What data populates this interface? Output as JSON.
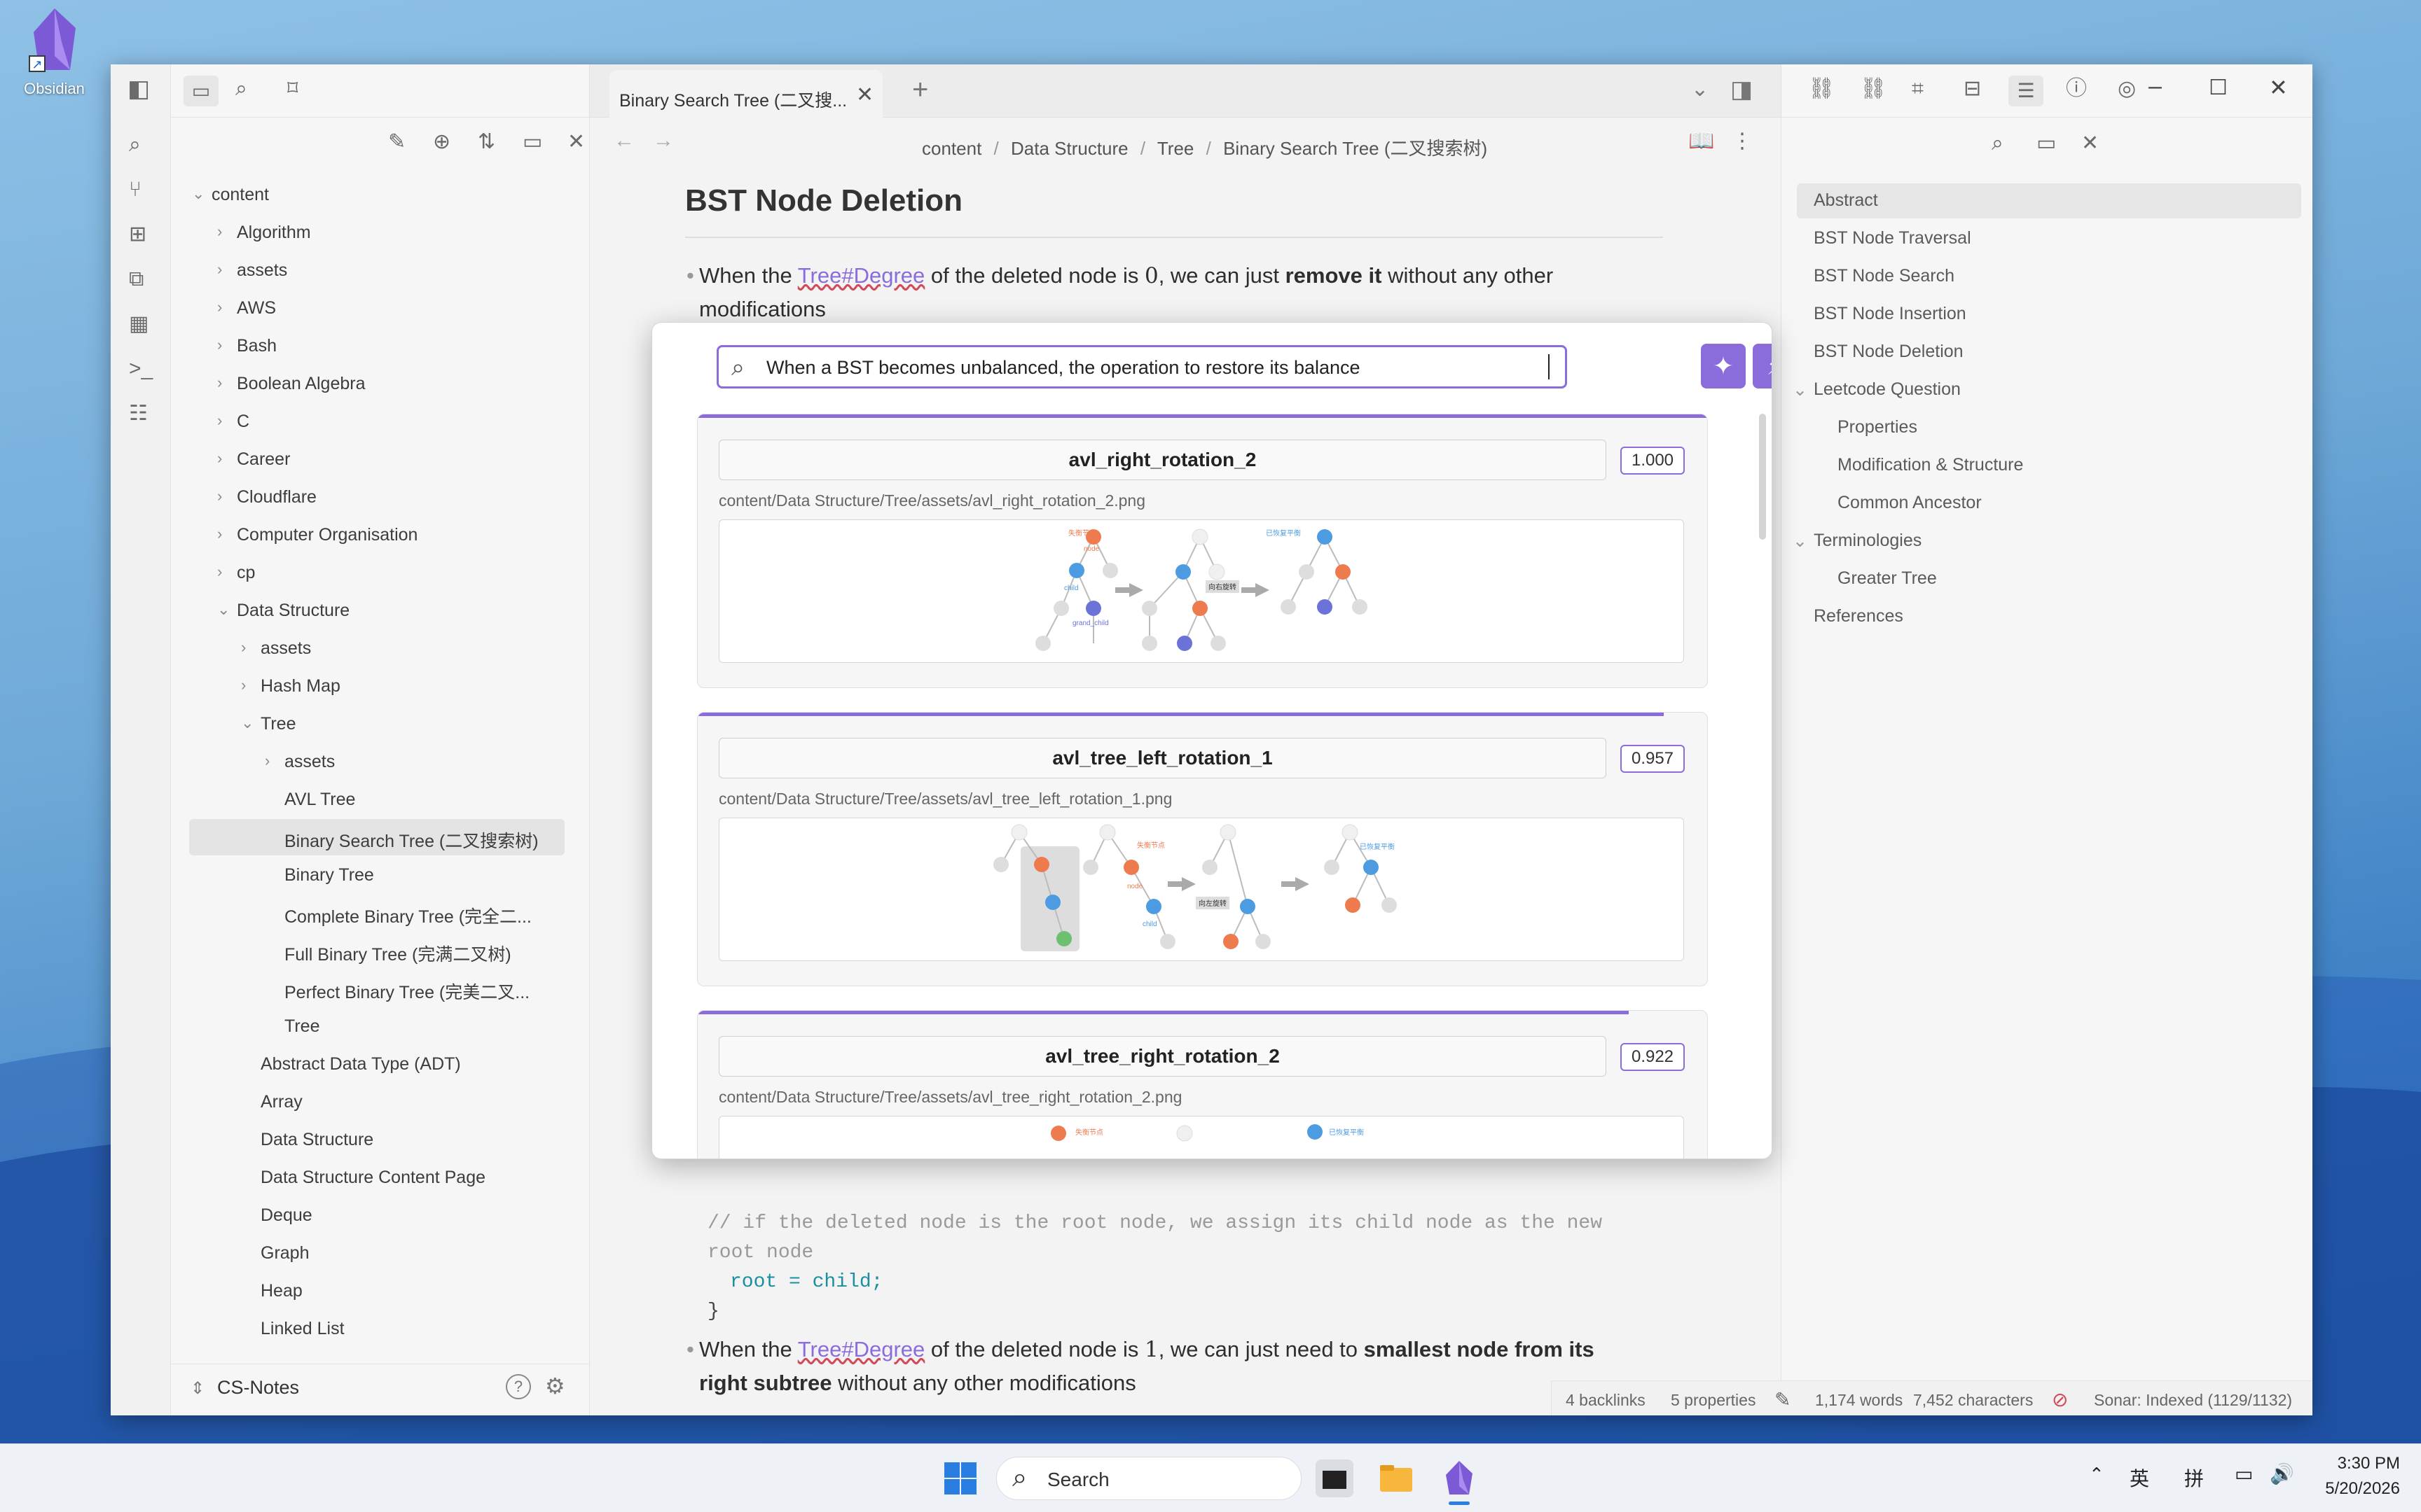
{
  "desktop": {
    "icon_label": "Obsidian"
  },
  "window": {
    "tab": {
      "title": "Binary Search Tree (二叉搜..."
    },
    "breadcrumb": [
      "content",
      "Data Structure",
      "Tree",
      "Binary Search Tree (二叉搜索树)"
    ],
    "breadcrumb_sep": "/",
    "note": {
      "heading": "BST Node Deletion",
      "p1": {
        "pre": "When the ",
        "link": "Tree#Degree",
        "mid": " of the deleted node is ",
        "num": "0",
        "post": ", we can just ",
        "bold": "remove it",
        "end": " without any other",
        "line2": "modifications"
      },
      "code": {
        "line1": "// if the deleted node is the root node, we assign its child node as the new",
        "line2": "root node",
        "line3": "root = child;",
        "line4": "}"
      },
      "p2": {
        "pre": "When the ",
        "link": "Tree#Degree",
        "mid": " of the deleted node is ",
        "num": "1",
        "post": ", we can just need to ",
        "bold": "smallest node from its",
        "bold2": "right subtree",
        "end": " without any other modifications"
      }
    },
    "file_tree": {
      "root": "content",
      "items": [
        {
          "label": "Algorithm"
        },
        {
          "label": "assets"
        },
        {
          "label": "AWS"
        },
        {
          "label": "Bash"
        },
        {
          "label": "Boolean Algebra"
        },
        {
          "label": "C"
        },
        {
          "label": "Career"
        },
        {
          "label": "Cloudflare"
        },
        {
          "label": "Computer Organisation"
        },
        {
          "label": "cp"
        },
        {
          "label": "Data Structure"
        },
        {
          "label": "assets"
        },
        {
          "label": "Hash Map"
        },
        {
          "label": "Tree"
        },
        {
          "label": "assets"
        },
        {
          "label": "AVL Tree"
        },
        {
          "label": "Binary Search Tree (二叉搜索树)"
        },
        {
          "label": "Binary Tree"
        },
        {
          "label": "Complete Binary Tree (完全二..."
        },
        {
          "label": "Full Binary Tree (完满二叉树)"
        },
        {
          "label": "Perfect Binary Tree (完美二叉..."
        },
        {
          "label": "Tree"
        },
        {
          "label": "Abstract Data Type (ADT)"
        },
        {
          "label": "Array"
        },
        {
          "label": "Data Structure"
        },
        {
          "label": "Data Structure Content Page"
        },
        {
          "label": "Deque"
        },
        {
          "label": "Graph"
        },
        {
          "label": "Heap"
        },
        {
          "label": "Linked List"
        }
      ]
    },
    "vault": {
      "name": "CS-Notes"
    },
    "outline": [
      {
        "label": "Abstract"
      },
      {
        "label": "BST Node Traversal"
      },
      {
        "label": "BST Node Search"
      },
      {
        "label": "BST Node Insertion"
      },
      {
        "label": "BST Node Deletion"
      },
      {
        "label": "Leetcode Question"
      },
      {
        "label": "Properties"
      },
      {
        "label": "Modification & Structure"
      },
      {
        "label": "Common Ancestor"
      },
      {
        "label": "Terminologies"
      },
      {
        "label": "Greater Tree"
      },
      {
        "label": "References"
      }
    ],
    "status_bar": {
      "backlinks": "4 backlinks",
      "properties": "5 properties",
      "words": "1,174 words",
      "characters": "7,452 characters",
      "sonar": "Sonar: Indexed (1129/1132)"
    }
  },
  "modal": {
    "query": "When a BST becomes unbalanced,  the operation to restore  its balance",
    "results": [
      {
        "title": "avl_right_rotation_2",
        "score": "1.000",
        "path": "content/Data Structure/Tree/assets/avl_right_rotation_2.png",
        "score_fraction": 1.0
      },
      {
        "title": "avl_tree_left_rotation_1",
        "score": "0.957",
        "path": "content/Data Structure/Tree/assets/avl_tree_left_rotation_1.png",
        "score_fraction": 0.957
      },
      {
        "title": "avl_tree_right_rotation_2",
        "score": "0.922",
        "path": "content/Data Structure/Tree/assets/avl_tree_right_rotation_2.png",
        "score_fraction": 0.922
      }
    ],
    "diagram_labels": {
      "a": "失衡节点",
      "b": "node",
      "c": "child",
      "d": "grand_child",
      "e": "向右旋转",
      "f": "已恢复平衡",
      "g": "向左旋转"
    }
  },
  "taskbar": {
    "search": "Search",
    "ime1": "英",
    "ime2": "拼",
    "time": "3:30 PM",
    "date": "5/20/2026"
  },
  "colors": {
    "accent": "#8b6cdb",
    "orange": "#ee7b4e",
    "blue": "#4d9be0",
    "purple": "#6c73d8",
    "green": "#6cc070"
  }
}
